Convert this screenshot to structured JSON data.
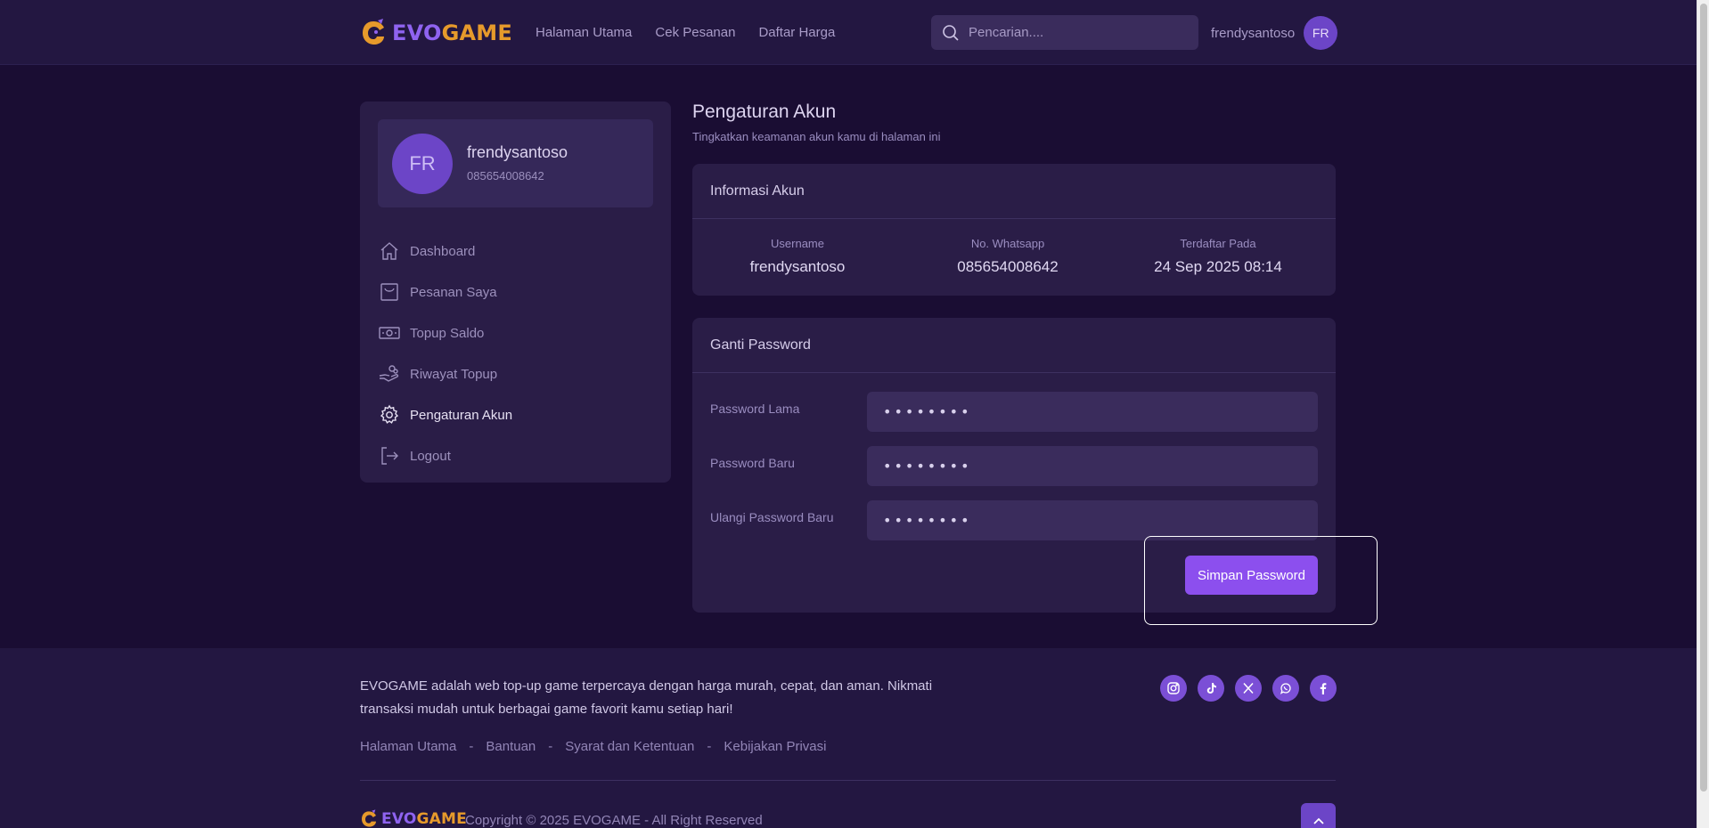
{
  "brand": {
    "evo": "EVO",
    "game": "GAME"
  },
  "header": {
    "nav": [
      "Halaman Utama",
      "Cek Pesanan",
      "Daftar Harga"
    ],
    "search_placeholder": "Pencarian....",
    "username": "frendysantoso",
    "avatar_initials": "FR"
  },
  "sidebar": {
    "profile": {
      "initials": "FR",
      "name": "frendysantoso",
      "phone": "085654008642"
    },
    "items": [
      {
        "label": "Dashboard",
        "icon": "home-icon"
      },
      {
        "label": "Pesanan Saya",
        "icon": "bag-icon"
      },
      {
        "label": "Topup Saldo",
        "icon": "money-icon"
      },
      {
        "label": "Riwayat Topup",
        "icon": "hand-coins-icon"
      },
      {
        "label": "Pengaturan Akun",
        "icon": "gear-icon",
        "active": true
      },
      {
        "label": "Logout",
        "icon": "logout-icon"
      }
    ]
  },
  "main": {
    "title": "Pengaturan Akun",
    "subtitle": "Tingkatkan keamanan akun kamu di halaman ini",
    "account_info": {
      "heading": "Informasi Akun",
      "fields": [
        {
          "label": "Username",
          "value": "frendysantoso"
        },
        {
          "label": "No. Whatsapp",
          "value": "085654008642"
        },
        {
          "label": "Terdaftar Pada",
          "value": "24 Sep 2025 08:14"
        }
      ]
    },
    "change_password": {
      "heading": "Ganti Password",
      "fields": [
        {
          "label": "Password Lama",
          "value": "••••••••"
        },
        {
          "label": "Password Baru",
          "value": "••••••••"
        },
        {
          "label": "Ulangi Password Baru",
          "value": "••••••••"
        }
      ],
      "submit_label": "Simpan Password"
    }
  },
  "footer": {
    "description": "EVOGAME adalah web top-up game terpercaya dengan harga murah, cepat, dan aman. Nikmati transaksi mudah untuk berbagai game favorit kamu setiap hari!",
    "links": [
      "Halaman Utama",
      "Bantuan",
      "Syarat dan Ketentuan",
      "Kebijakan Privasi"
    ],
    "link_separator": "-",
    "socials": [
      "instagram-icon",
      "tiktok-icon",
      "x-icon",
      "whatsapp-icon",
      "facebook-icon"
    ],
    "copyright": "Copyright © 2025 EVOGAME - All Right Reserved"
  },
  "colors": {
    "accent": "#8c4fee",
    "brand_purple": "#8f63f0",
    "brand_orange": "#e69a2b",
    "background": "#1a0d33"
  }
}
